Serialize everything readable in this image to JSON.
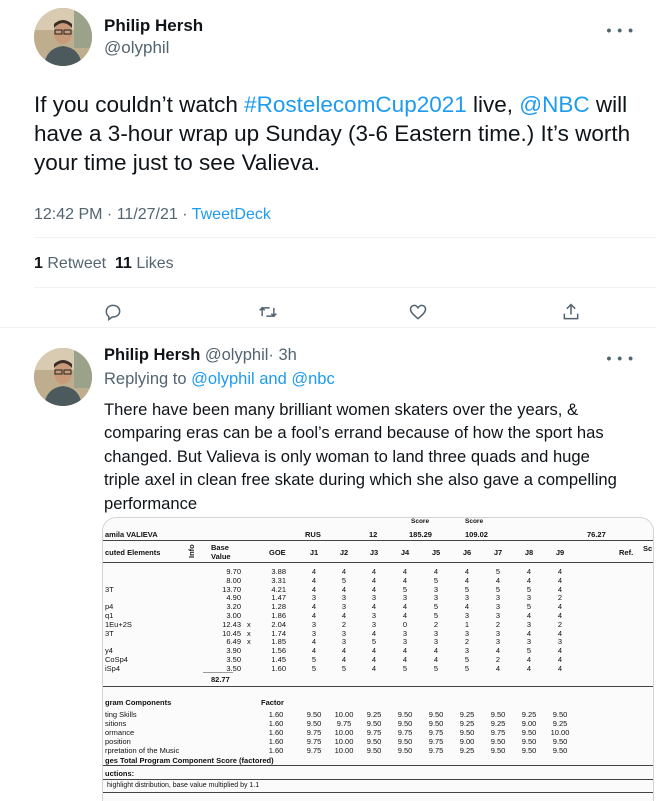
{
  "main_tweet": {
    "author_name": "Philip Hersh",
    "author_handle": "@olyphil",
    "text_parts": [
      "If you couldn’t watch ",
      "#RostelecomCup2021",
      " live, ",
      "@NBC",
      " will have a 3-hour wrap up Sunday (3-6 Eastern time.)  It’s worth your time just to see Valieva."
    ],
    "time": "12:42 PM · 11/27/21 · ",
    "source": "TweetDeck",
    "retweets_count": "1",
    "retweets_label": "Retweet",
    "likes_count": "11",
    "likes_label": "Likes",
    "more_icon": "ellipsis-icon"
  },
  "actions": [
    {
      "name": "reply-icon"
    },
    {
      "name": "retweet-icon"
    },
    {
      "name": "like-icon"
    },
    {
      "name": "share-icon"
    }
  ],
  "reply_tweet": {
    "author_name": "Philip Hersh",
    "author_handle": "@olyphil",
    "time": "· 3h",
    "replying_prefix": "Replying to ",
    "replying_to_1": "@olyphil",
    "replying_and": " and ",
    "replying_to_2": "@nbc",
    "text": "There have been many brilliant women skaters over the years, & comparing eras can be a fool’s errand because of how the sport has changed.  But Valieva is only woman to land three quads and huge triple axel in clean free skate during which she also gave a compelling performance"
  },
  "scoresheet": {
    "skater": "amila VALIEVA",
    "nation": "RUS",
    "start_no": "12",
    "score_hdr_1": "Score",
    "score_hdr_2": "Score",
    "total_score": "185.29",
    "tes": "109.02",
    "pcs": "76.27",
    "col_elements": "cuted Elements",
    "col_info": "Info",
    "col_base": "Base",
    "col_value": "Value",
    "col_goe": "GOE",
    "judges": [
      "J1",
      "J2",
      "J3",
      "J4",
      "J5",
      "J6",
      "J7",
      "J8",
      "J9"
    ],
    "col_ref": "Ref.",
    "col_sc": "Sc",
    "elements": [
      {
        "name": "",
        "x": "",
        "base": "9.70",
        "goe": "3.88",
        "j": [
          "4",
          "4",
          "4",
          "4",
          "4",
          "4",
          "5",
          "4",
          "4"
        ]
      },
      {
        "name": "",
        "x": "",
        "base": "8.00",
        "goe": "3.31",
        "j": [
          "4",
          "5",
          "4",
          "4",
          "5",
          "4",
          "4",
          "4",
          "4"
        ]
      },
      {
        "name": "3T",
        "x": "",
        "base": "13.70",
        "goe": "4.21",
        "j": [
          "4",
          "4",
          "4",
          "5",
          "3",
          "5",
          "5",
          "5",
          "4"
        ]
      },
      {
        "name": "",
        "x": "",
        "base": "4.90",
        "goe": "1.47",
        "j": [
          "3",
          "3",
          "3",
          "3",
          "3",
          "3",
          "3",
          "3",
          "2"
        ]
      },
      {
        "name": "p4",
        "x": "",
        "base": "3.20",
        "goe": "1.28",
        "j": [
          "4",
          "3",
          "4",
          "4",
          "5",
          "4",
          "3",
          "5",
          "4"
        ]
      },
      {
        "name": "q1",
        "x": "",
        "base": "3.00",
        "goe": "1.86",
        "j": [
          "4",
          "4",
          "3",
          "4",
          "5",
          "3",
          "3",
          "4",
          "4"
        ]
      },
      {
        "name": "1Eu+2S",
        "x": "x",
        "base": "12.43",
        "goe": "2.04",
        "j": [
          "3",
          "2",
          "3",
          "0",
          "2",
          "1",
          "2",
          "3",
          "2"
        ]
      },
      {
        "name": "3T",
        "x": "x",
        "base": "10.45",
        "goe": "1.74",
        "j": [
          "3",
          "3",
          "4",
          "3",
          "3",
          "3",
          "3",
          "4",
          "4"
        ]
      },
      {
        "name": "",
        "x": "x",
        "base": "6.49",
        "goe": "1.85",
        "j": [
          "4",
          "3",
          "5",
          "3",
          "3",
          "2",
          "3",
          "3",
          "3"
        ]
      },
      {
        "name": "y4",
        "x": "",
        "base": "3.90",
        "goe": "1.56",
        "j": [
          "4",
          "4",
          "4",
          "4",
          "4",
          "3",
          "4",
          "5",
          "4"
        ]
      },
      {
        "name": "CoSp4",
        "x": "",
        "base": "3.50",
        "goe": "1.45",
        "j": [
          "5",
          "4",
          "4",
          "4",
          "4",
          "5",
          "2",
          "4",
          "4"
        ]
      },
      {
        "name": "iSp4",
        "x": "",
        "base": "3.50",
        "goe": "1.60",
        "j": [
          "5",
          "5",
          "4",
          "5",
          "5",
          "5",
          "4",
          "4",
          "4"
        ]
      }
    ],
    "base_total": "82.77",
    "pc_header": "gram Components",
    "factor_label": "Factor",
    "components": [
      {
        "name": "ting Skills",
        "factor": "1.60",
        "j": [
          "9.50",
          "10.00",
          "9.25",
          "9.50",
          "9.50",
          "9.25",
          "9.50",
          "9.25",
          "9.50"
        ]
      },
      {
        "name": "sitions",
        "factor": "1.60",
        "j": [
          "9.50",
          "9.75",
          "9.50",
          "9.50",
          "9.50",
          "9.25",
          "9.25",
          "9.00",
          "9.25"
        ]
      },
      {
        "name": "ormance",
        "factor": "1.60",
        "j": [
          "9.75",
          "10.00",
          "9.75",
          "9.75",
          "9.75",
          "9.50",
          "9.75",
          "9.50",
          "10.00"
        ]
      },
      {
        "name": "position",
        "factor": "1.60",
        "j": [
          "9.75",
          "10.00",
          "9.50",
          "9.50",
          "9.75",
          "9.00",
          "9.50",
          "9.50",
          "9.50"
        ]
      },
      {
        "name": "rpretation of the Music",
        "factor": "1.60",
        "j": [
          "9.75",
          "10.00",
          "9.50",
          "9.50",
          "9.75",
          "9.25",
          "9.50",
          "9.50",
          "9.50"
        ]
      }
    ],
    "pcs_total_label": "ges Total Program Component Score (factored)",
    "deductions_label": "uctions:",
    "footnote": "highlight distribution, base value multiplied by 1.1"
  }
}
